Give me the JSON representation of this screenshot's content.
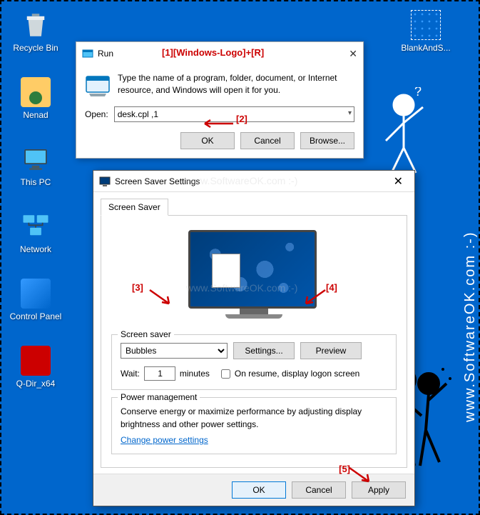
{
  "desktop": {
    "icons": {
      "recycle": "Recycle Bin",
      "nenad": "Nenad",
      "thispc": "This PC",
      "network": "Network",
      "controlpanel": "Control Panel",
      "qdir": "Q-Dir_x64",
      "blank": "BlankAndS..."
    }
  },
  "watermark": {
    "side": "www.SoftwareOK.com :-)",
    "faint": "www.SoftwareOK.com :-)"
  },
  "annotations": {
    "a1": "[1][Windows-Logo]+[R]",
    "a2": "[2]",
    "a3": "[3]",
    "a4": "[4]",
    "a5": "[5]"
  },
  "run": {
    "title": "Run",
    "desc": "Type the name of a program, folder, document, or Internet resource, and Windows will open it for you.",
    "open_label": "Open:",
    "open_value": "desk.cpl ,1",
    "ok": "OK",
    "cancel": "Cancel",
    "browse": "Browse..."
  },
  "ss": {
    "title": "Screen Saver Settings",
    "tab": "Screen Saver",
    "legend": "Screen saver",
    "selected": "Bubbles",
    "settings_btn": "Settings...",
    "preview_btn": "Preview",
    "wait_label": "Wait:",
    "wait_value": "1",
    "wait_unit": "minutes",
    "resume_label": "On resume, display logon screen",
    "power_legend": "Power management",
    "power_text": "Conserve energy or maximize performance by adjusting display brightness and other power settings.",
    "power_link": "Change power settings",
    "ok": "OK",
    "cancel": "Cancel",
    "apply": "Apply"
  }
}
